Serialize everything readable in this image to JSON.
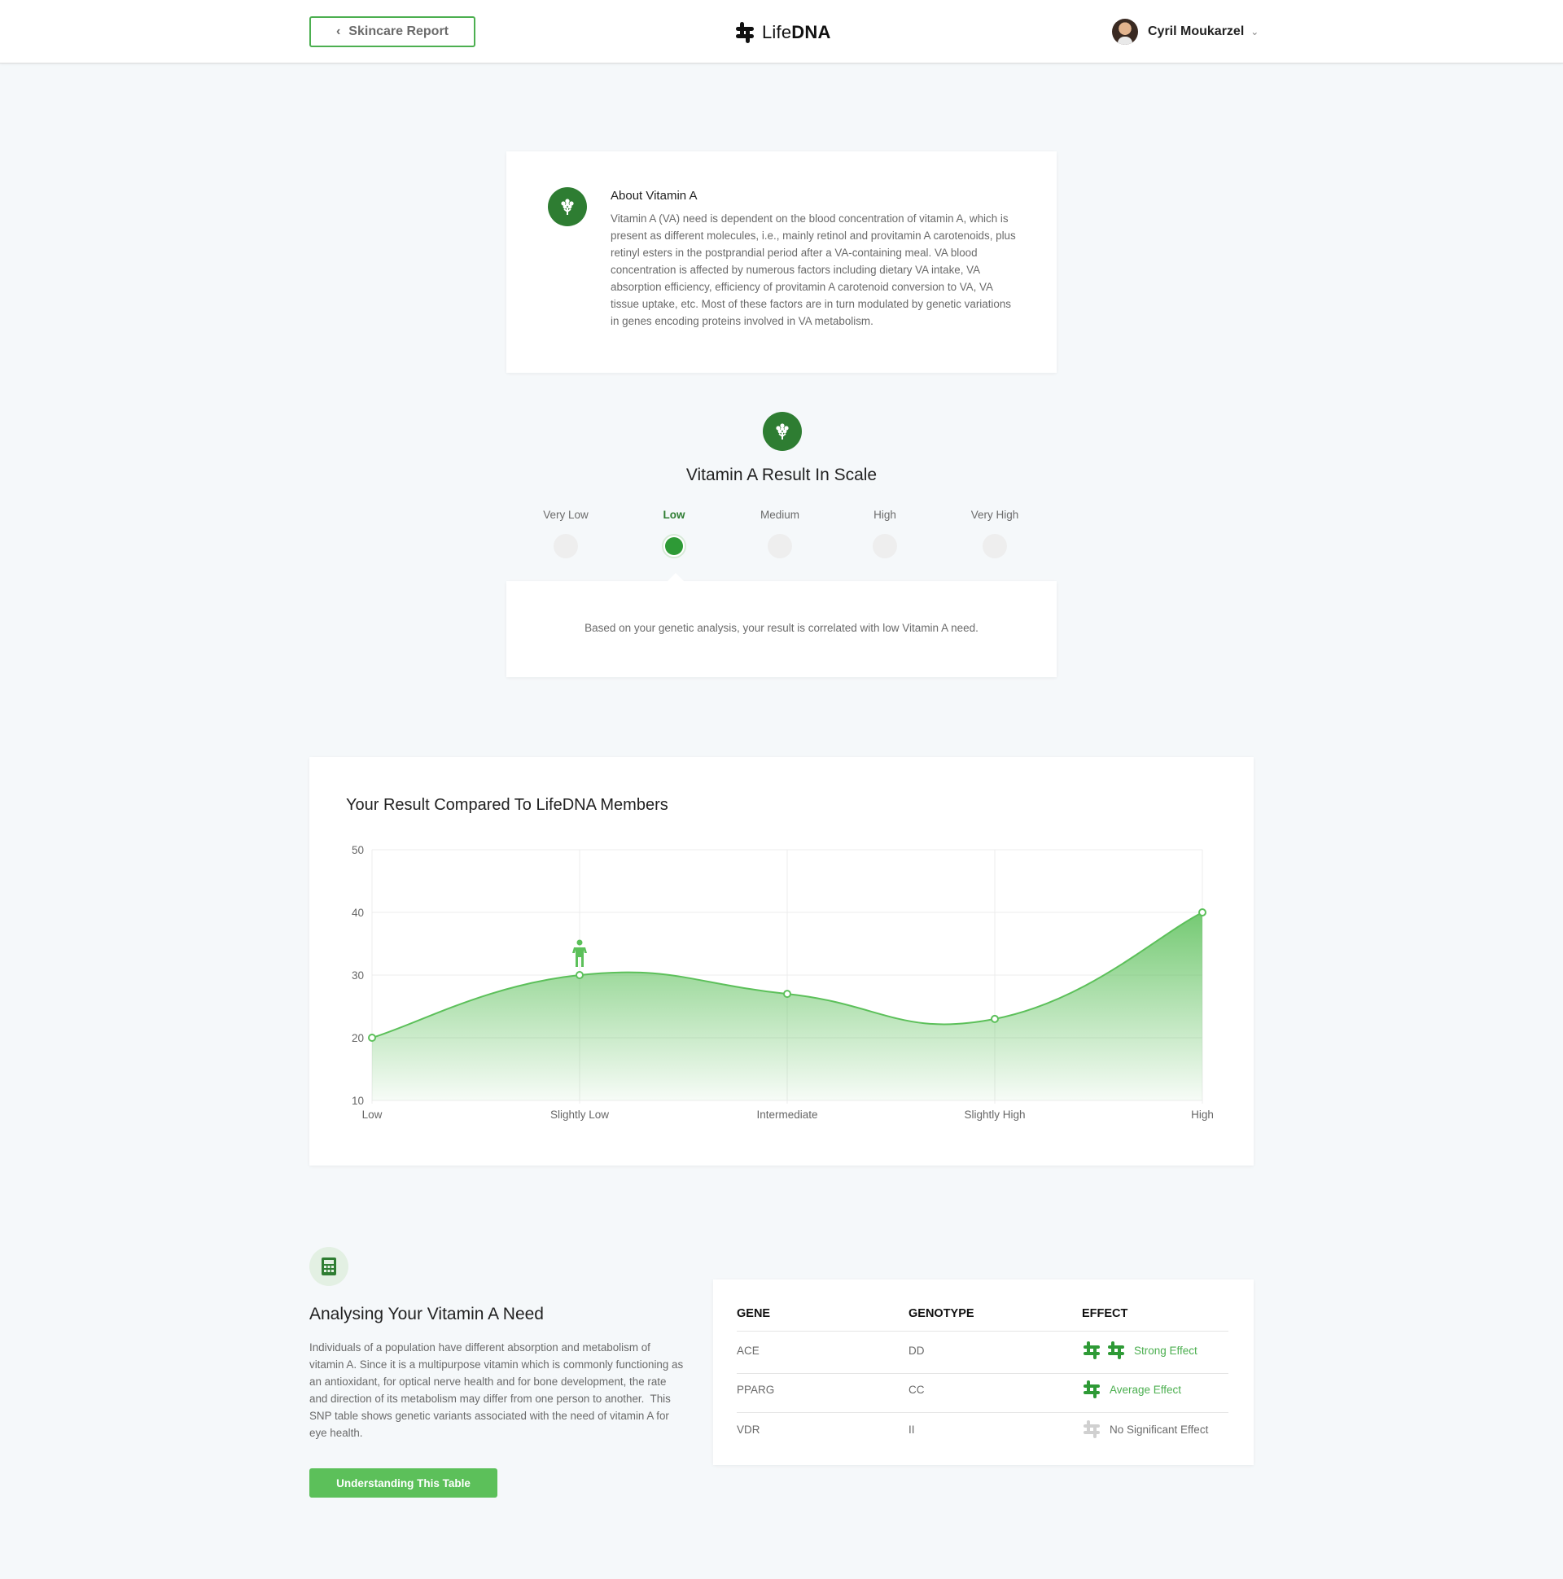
{
  "header": {
    "back_label": "Skincare Report",
    "logo_text_light": "Life",
    "logo_text_bold": "DNA",
    "user_name": "Cyril Moukarzel"
  },
  "about": {
    "title": "About Vitamin A",
    "text": "Vitamin A (VA) need is dependent on the blood concentration of vitamin A, which is present as different molecules, i.e., mainly retinol and provitamin A carotenoids, plus retinyl esters in the postprandial period after a VA-containing meal. VA blood concentration is affected by numerous factors including dietary VA intake, VA absorption efficiency, efficiency of provitamin A carotenoid conversion to VA, VA tissue uptake, etc. Most of these factors are in turn modulated by genetic variations in genes encoding proteins involved in VA metabolism."
  },
  "scale": {
    "title": "Vitamin A Result In Scale",
    "levels": [
      "Very Low",
      "Low",
      "Medium",
      "High",
      "Very High"
    ],
    "selected_index": 1,
    "result_text": "Based on your genetic analysis, your result is correlated with low Vitamin A need."
  },
  "chart_title": "Your Result Compared To LifeDNA Members",
  "chart_data": {
    "type": "area",
    "categories": [
      "Low",
      "Slightly Low",
      "Intermediate",
      "Slightly High",
      "High"
    ],
    "values": [
      20,
      30,
      27,
      23,
      40
    ],
    "ylim": [
      10,
      50
    ],
    "yticks": [
      10,
      20,
      30,
      40,
      50
    ],
    "user_marker_category": "Slightly Low",
    "grid": true,
    "color": "#5cc05a"
  },
  "analysis": {
    "title": "Analysing Your Vitamin A Need",
    "text": "Individuals of a population have different absorption and metabolism of vitamin A. Since it is a multipurpose vitamin which is commonly functioning as an antioxidant, for optical nerve health and for bone development, the rate and direction of its metabolism may differ from one person to another.  This SNP table shows genetic variants associated with the need of vitamin A for eye health.",
    "button_label": "Understanding This Table"
  },
  "snp_table": {
    "headers": [
      "GENE",
      "GENOTYPE",
      "EFFECT"
    ],
    "rows": [
      {
        "gene": "ACE",
        "genotype": "DD",
        "effect": "Strong Effect",
        "level": "strong"
      },
      {
        "gene": "PPARG",
        "genotype": "CC",
        "effect": "Average Effect",
        "level": "average"
      },
      {
        "gene": "VDR",
        "genotype": "II",
        "effect": "No Significant Effect",
        "level": "none"
      }
    ]
  },
  "colors": {
    "brand_green": "#2e7d32",
    "accent_green": "#5cc05a",
    "background": "#f5f8fa"
  },
  "icons": [
    "chevron-left-icon",
    "lifedna-logo-icon",
    "chevron-down-icon",
    "plant-icon",
    "person-icon",
    "calculator-icon",
    "dna-effect-icon"
  ]
}
